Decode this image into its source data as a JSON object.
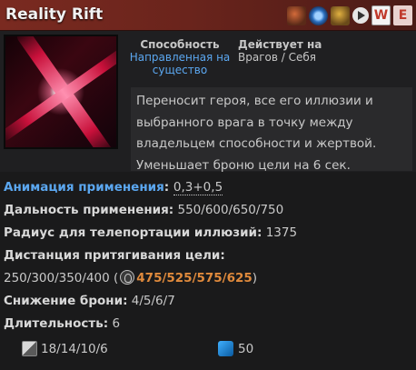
{
  "header": {
    "title": "Reality Rift",
    "icons": [
      "aghanims-scepter-icon",
      "aghanims-shard-icon",
      "innate-icon",
      "play-video-icon"
    ],
    "hotkeys": [
      "W",
      "E"
    ]
  },
  "ability": {
    "icon": "reality-rift-icon",
    "targeting_label": "Способность",
    "targeting_value": "Направленная на существо",
    "affects_label": "Действует на",
    "affects_value": "Врагов / Себя",
    "description": "Переносит героя, все его иллюзии и выбранного врага в точку между владельцем способности и жертвой. Уменьшает броню цели на 6 сек."
  },
  "stats": {
    "cast_animation_label": "Анимация применения",
    "cast_animation_value": "0,3+0,5",
    "cast_range_label": "Дальность применения:",
    "cast_range_value": "550/600/650/750",
    "illusion_radius_label": "Радиус для телепортации иллюзий:",
    "illusion_radius_value": "1375",
    "pull_distance_label": "Дистанция притягивания цели:",
    "pull_distance_value": "250/300/350/400",
    "pull_distance_talent_value": "475/525/575/625",
    "armor_reduction_label": "Снижение брони:",
    "armor_reduction_value": "4/5/6/7",
    "duration_label": "Длительность:",
    "duration_value": "6"
  },
  "footer": {
    "cooldown_icon": "cooldown-icon",
    "cooldown_value": "18/14/10/6",
    "mana_icon": "mana-icon",
    "mana_value": "50"
  },
  "colors": {
    "header": "#7a2a20",
    "accent_blue": "#5ba7f0",
    "talent_orange": "#e08a3c",
    "background": "#1a1a1b"
  }
}
